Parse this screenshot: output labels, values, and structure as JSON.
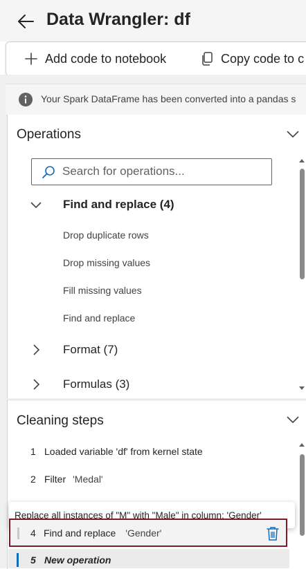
{
  "header": {
    "title": "Data Wrangler: df",
    "back_icon": "arrow-left-icon"
  },
  "toolbar": {
    "add_code_label": "Add code to notebook",
    "add_icon": "plus-icon",
    "copy_code_label": "Copy code to c",
    "copy_icon": "copy-icon"
  },
  "info": {
    "text": "Your Spark DataFrame has been converted into a pandas s",
    "icon": "info-icon"
  },
  "operations": {
    "title": "Operations",
    "search_placeholder": "Search for operations...",
    "groups": [
      {
        "label": "Find and replace (4)",
        "expanded": true,
        "items": [
          "Drop duplicate rows",
          "Drop missing values",
          "Fill missing values",
          "Find and replace"
        ]
      },
      {
        "label": "Format (7)",
        "expanded": false
      },
      {
        "label": "Formulas (3)",
        "expanded": false
      }
    ]
  },
  "cleaning_steps": {
    "title": "Cleaning steps",
    "steps": [
      {
        "num": "1",
        "label": "Loaded variable 'df' from kernel state",
        "arg": ""
      },
      {
        "num": "2",
        "label": "Filter",
        "arg": "'Medal'"
      },
      {
        "num": "4",
        "label": "Find and replace",
        "arg": "'Gender'"
      },
      {
        "num": "5",
        "label": "New operation",
        "arg": ""
      }
    ],
    "tooltip": "Replace all instances of \"M\" with \"Male\" in column: 'Gender'"
  },
  "colors": {
    "selected_border": "#7a1a2b",
    "accent": "#0f6cbd",
    "trash": "#0f6cbd"
  }
}
